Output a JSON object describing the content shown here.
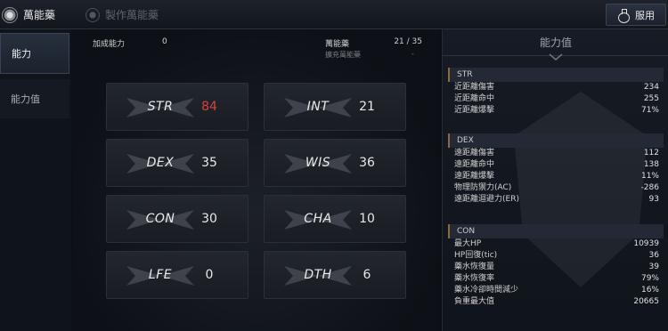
{
  "header": {
    "tab_active": "萬能藥",
    "tab_inactive": "製作萬能藥",
    "use_button": "服用"
  },
  "sidebar": {
    "items": [
      {
        "label": "能力"
      },
      {
        "label": "能力值"
      }
    ]
  },
  "summary": {
    "bonus_label": "加成能力",
    "bonus_value": "0",
    "potion_label": "萬能藥",
    "potion_value": "21 / 35",
    "expand_label": "擴充萬能藥",
    "expand_value": "-"
  },
  "stats": [
    {
      "name": "STR",
      "value": "84",
      "highlight": true
    },
    {
      "name": "INT",
      "value": "21",
      "highlight": false
    },
    {
      "name": "DEX",
      "value": "35",
      "highlight": false
    },
    {
      "name": "WIS",
      "value": "36",
      "highlight": false
    },
    {
      "name": "CON",
      "value": "30",
      "highlight": false
    },
    {
      "name": "CHA",
      "value": "10",
      "highlight": false
    },
    {
      "name": "LFE",
      "value": "0",
      "highlight": false
    },
    {
      "name": "DTH",
      "value": "6",
      "highlight": false
    }
  ],
  "panel": {
    "title": "能力值",
    "sections": [
      {
        "name": "STR",
        "rows": [
          {
            "label": "近距離傷害",
            "value": "234"
          },
          {
            "label": "近距離命中",
            "value": "255"
          },
          {
            "label": "近距離爆擊",
            "value": "71%"
          }
        ]
      },
      {
        "name": "DEX",
        "rows": [
          {
            "label": "遠距離傷害",
            "value": "112"
          },
          {
            "label": "遠距離命中",
            "value": "138"
          },
          {
            "label": "遠距離爆擊",
            "value": "11%"
          },
          {
            "label": "物理防禦力(AC)",
            "value": "-286"
          },
          {
            "label": "遠距離迴避力(ER)",
            "value": "93"
          }
        ]
      },
      {
        "name": "CON",
        "rows": [
          {
            "label": "最大HP",
            "value": "10939"
          },
          {
            "label": "HP回復(tic)",
            "value": "36"
          },
          {
            "label": "藥水恢復量",
            "value": "39"
          },
          {
            "label": "藥水恢復率",
            "value": "79%"
          },
          {
            "label": "藥水冷卻時間減少",
            "value": "16%"
          },
          {
            "label": "負重最大值",
            "value": "20665"
          }
        ]
      }
    ]
  },
  "colors": {
    "highlight": "#d9413f",
    "section_accent": "#8c6b3a"
  }
}
